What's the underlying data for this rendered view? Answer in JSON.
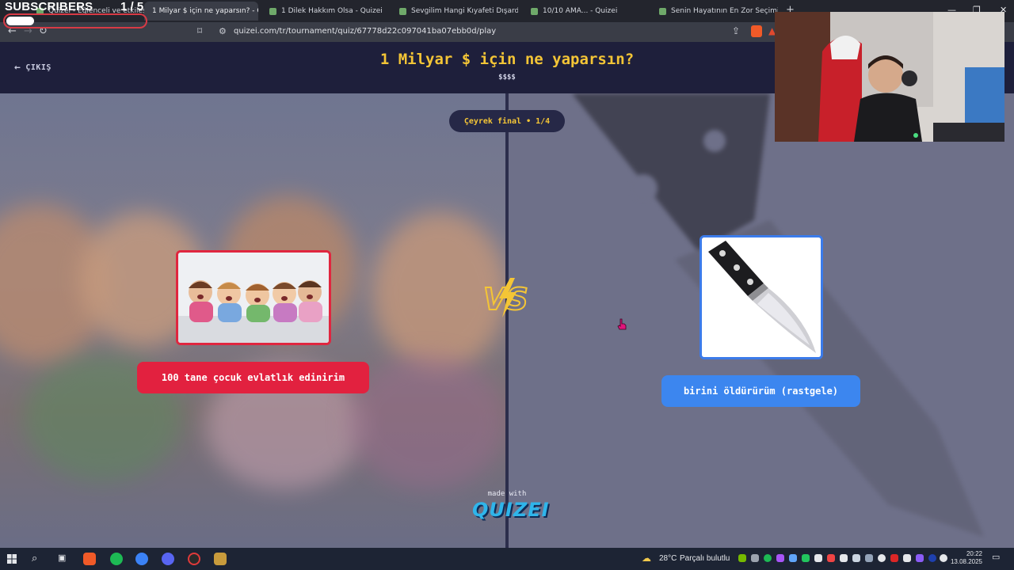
{
  "browser": {
    "tabs": [
      {
        "label": "Quizei - Eğlenceli ve etkileşimli quiz",
        "active": false
      },
      {
        "label": "1 Milyar $ için ne yaparsın? - Qu",
        "active": true
      },
      {
        "label": "1 Dilek Hakkım Olsa - Quizei",
        "active": false
      },
      {
        "label": "Sevgilim Hangi Kıyafeti Dışarda Giye",
        "active": false
      },
      {
        "label": "10/10 AMA... - Quizei",
        "active": false
      },
      {
        "label": "Senin Hayatının En Zor Seçimi - Quiz",
        "active": false
      }
    ],
    "url": "quizei.com/tr/tournament/quiz/67778d22c097041ba07ebb0d/play",
    "new_tab_label": "+"
  },
  "overlay": {
    "subscribers_label": "SUBSCRIBERS",
    "subscribers_count": "1 / 5",
    "progress_fraction": 0.2
  },
  "page": {
    "exit_label": "ÇIKIŞ",
    "title": "1 Milyar $ için ne yaparsın?",
    "subtitle": "$$$$",
    "round_label": "Çeyrek final • 1/4"
  },
  "choices": {
    "left": {
      "label": "100 tane çocuk evlatlık edinirim",
      "color": "#e2213f"
    },
    "right": {
      "label": "birini öldürürüm (rastgele)",
      "color": "#3c86ef"
    }
  },
  "footer": {
    "made_with": "made with",
    "brand": "QUIZEI"
  },
  "taskbar": {
    "weather_temp": "28°C",
    "weather_desc": "Parçalı bulutlu",
    "time": "20:22",
    "date": "13.08.2025"
  },
  "colors": {
    "accent_yellow": "#f4c536",
    "header_bg": "#1e1f3b",
    "red_choice": "#e2213f",
    "blue_choice": "#3c86ef"
  }
}
